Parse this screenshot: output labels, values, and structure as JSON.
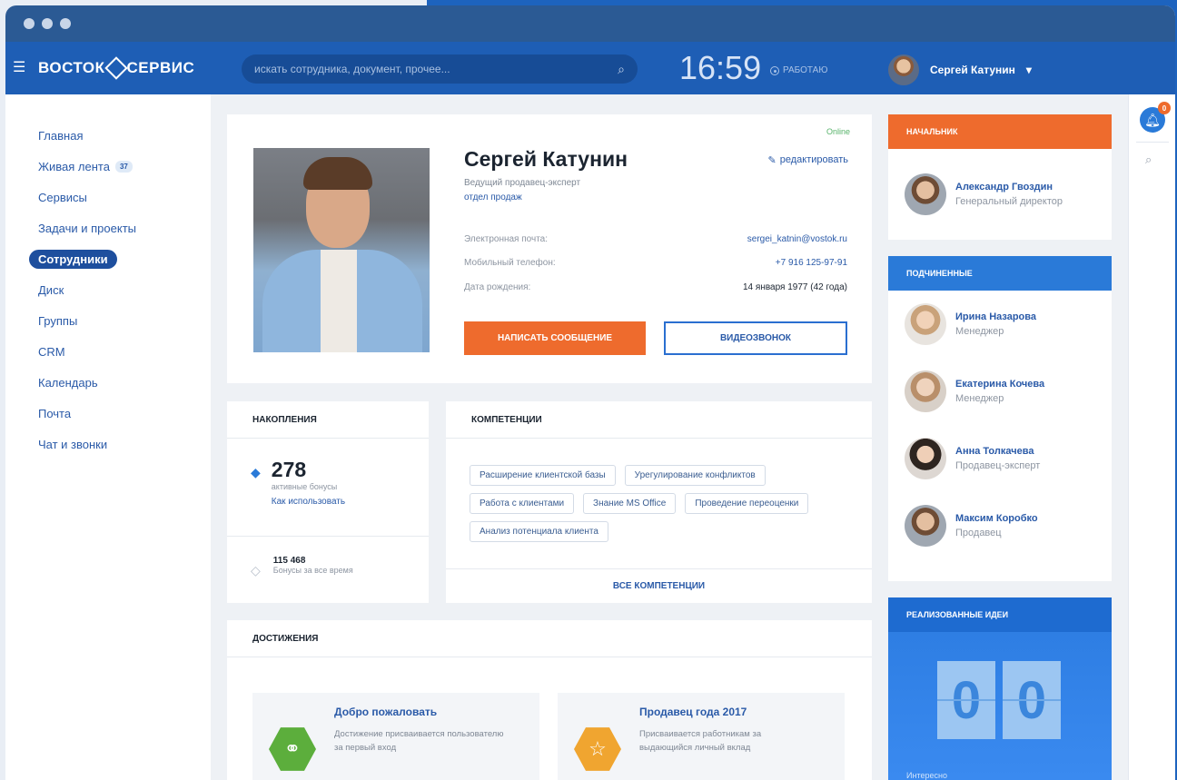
{
  "topbar": {
    "logo": "ВОСТОК",
    "logo2": "СЕРВИС",
    "search_placeholder": "искать сотрудника, документ, прочее...",
    "time": "16:59",
    "status": "РАБОТАЮ",
    "user_name": "Сергей Катунин",
    "user_caret": "▾"
  },
  "sidebar": {
    "items": [
      {
        "label": "Главная"
      },
      {
        "label": "Живая лента",
        "badge": "37"
      },
      {
        "label": "Сервисы"
      },
      {
        "label": "Задачи и проекты"
      },
      {
        "label": "Сотрудники"
      },
      {
        "label": "Диск"
      },
      {
        "label": "Группы"
      },
      {
        "label": "CRM"
      },
      {
        "label": "Календарь"
      },
      {
        "label": "Почта"
      },
      {
        "label": "Чат и звонки"
      }
    ],
    "active_index": 4
  },
  "profile": {
    "online": "Online",
    "name": "Сергей Катунин",
    "edit": "редактировать",
    "role": "Ведущий продавец-эксперт",
    "dept": "отдел продаж",
    "email_label": "Электронная почта:",
    "email": "sergei_katnin@vostok.ru",
    "phone_label": "Мобильный телефон:",
    "phone": "+7 916 125-97-91",
    "birth_label": "Дата рождения:",
    "birth": "14 января 1977 (42 года)",
    "btn_message": "НАПИСАТЬ СООБЩЕНИЕ",
    "btn_video": "ВИДЕОЗВОНОК"
  },
  "bonus": {
    "title": "НАКОПЛЕНИЯ",
    "value": "278",
    "value_label": "активные бонусы",
    "link": "Как использовать",
    "total": "115 468",
    "total_label": "Бонусы за все время"
  },
  "skills": {
    "title": "КОМПЕТЕНЦИИ",
    "tags": [
      "Расширение клиентской базы",
      "Урегулирование конфликтов",
      "Работа с клиентами",
      "Знание MS Office",
      "Проведение переоценки",
      "Анализ потенциала клиента"
    ],
    "all": "ВСЕ КОМПЕТЕНЦИИ"
  },
  "achievements": {
    "title": "ДОСТИЖЕНИЯ",
    "items": [
      {
        "title": "Добро пожаловать",
        "desc": "Достижение присваивается пользователю за первый вход",
        "color": "#5cae3c",
        "icon": "handshake-icon"
      },
      {
        "title": "Продавец года 2017",
        "desc": "Присваивается работникам за выдающийся личный вклад",
        "color": "#f0a530",
        "icon": "star-icon"
      }
    ]
  },
  "boss": {
    "title": "НАЧАЛЬНИК",
    "name": "Александр Гвоздин",
    "role": "Генеральный директор"
  },
  "subordinates": {
    "title": "ПОДЧИНЕННЫЕ",
    "items": [
      {
        "name": "Ирина Назарова",
        "role": "Менеджер"
      },
      {
        "name": "Екатерина Кочева",
        "role": "Менеджер"
      },
      {
        "name": "Анна Толкачева",
        "role": "Продавец-эксперт"
      },
      {
        "name": "Максим Коробко",
        "role": "Продавец"
      }
    ]
  },
  "ideas": {
    "title": "РЕАЛИЗОВАННЫЕ ИДЕИ",
    "digit1": "0",
    "digit2": "0",
    "foot": "Интересно"
  },
  "rail": {
    "notif_count": "0"
  },
  "colors": {
    "brand_blue": "#1e5eb5",
    "accent_orange": "#ee6b2d",
    "link_blue": "#2a5aa8"
  }
}
